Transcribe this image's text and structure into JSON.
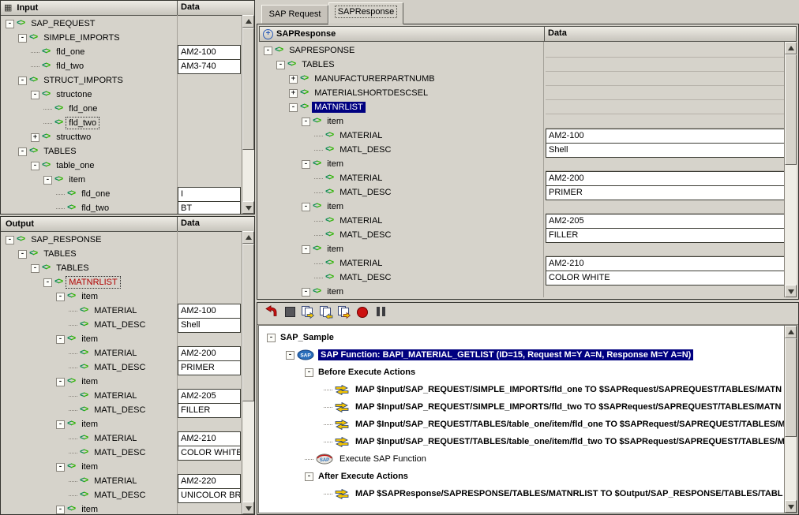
{
  "icons": {
    "xml_open": "<",
    "xml_close": ">",
    "grid_glyph": "▦",
    "plus_circle_glyph": "+"
  },
  "colors": {
    "selection": "#000080",
    "node_red": "#b20000",
    "xml_left": "#0a8a50",
    "xml_right": "#2ab400"
  },
  "tabs": {
    "items": [
      {
        "label": "SAP Request",
        "active": false
      },
      {
        "label": "SAPResponse",
        "active": true
      }
    ]
  },
  "input_panel": {
    "title": "Input",
    "data_header": "Data",
    "rows": [
      {
        "t": "SAP_REQUEST",
        "l": 0,
        "e": "-"
      },
      {
        "t": "SIMPLE_IMPORTS",
        "l": 1,
        "e": "-"
      },
      {
        "t": "fld_one",
        "l": 2,
        "v": "AM2-100"
      },
      {
        "t": "fld_two",
        "l": 2,
        "v": "AM3-740"
      },
      {
        "t": "STRUCT_IMPORTS",
        "l": 1,
        "e": "-"
      },
      {
        "t": "structone",
        "l": 2,
        "e": "-"
      },
      {
        "t": "fld_one",
        "l": 3
      },
      {
        "t": "fld_two",
        "l": 3,
        "focus": true
      },
      {
        "t": "structtwo",
        "l": 2,
        "e": "+"
      },
      {
        "t": "TABLES",
        "l": 1,
        "e": "-"
      },
      {
        "t": "table_one",
        "l": 2,
        "e": "-"
      },
      {
        "t": "item",
        "l": 3,
        "e": "-"
      },
      {
        "t": "fld_one",
        "l": 4,
        "v": "I"
      },
      {
        "t": "fld_two",
        "l": 4,
        "v": "BT"
      }
    ]
  },
  "output_panel": {
    "title": "Output",
    "data_header": "Data",
    "rows": [
      {
        "t": "SAP_RESPONSE",
        "l": 0,
        "e": "-"
      },
      {
        "t": "TABLES",
        "l": 1,
        "e": "-"
      },
      {
        "t": "TABLES",
        "l": 2,
        "e": "-"
      },
      {
        "t": "MATNRLIST",
        "l": 3,
        "e": "-",
        "red": true,
        "focus": true
      },
      {
        "t": "item",
        "l": 4,
        "e": "-"
      },
      {
        "t": "MATERIAL",
        "l": 5,
        "v": "AM2-100"
      },
      {
        "t": "MATL_DESC",
        "l": 5,
        "v": "Shell"
      },
      {
        "t": "item",
        "l": 4,
        "e": "-"
      },
      {
        "t": "MATERIAL",
        "l": 5,
        "v": "AM2-200"
      },
      {
        "t": "MATL_DESC",
        "l": 5,
        "v": "PRIMER"
      },
      {
        "t": "item",
        "l": 4,
        "e": "-"
      },
      {
        "t": "MATERIAL",
        "l": 5,
        "v": "AM2-205"
      },
      {
        "t": "MATL_DESC",
        "l": 5,
        "v": "FILLER"
      },
      {
        "t": "item",
        "l": 4,
        "e": "-"
      },
      {
        "t": "MATERIAL",
        "l": 5,
        "v": "AM2-210"
      },
      {
        "t": "MATL_DESC",
        "l": 5,
        "v": "COLOR WHITE"
      },
      {
        "t": "item",
        "l": 4,
        "e": "-"
      },
      {
        "t": "MATERIAL",
        "l": 5,
        "v": "AM2-220"
      },
      {
        "t": "MATL_DESC",
        "l": 5,
        "v": "UNICOLOR BR"
      },
      {
        "t": "item",
        "l": 4,
        "e": "-"
      }
    ]
  },
  "response_panel": {
    "title": "SAPResponse",
    "data_header": "Data",
    "rows": [
      {
        "t": "SAPRESPONSE",
        "l": 0,
        "e": "-"
      },
      {
        "t": "TABLES",
        "l": 1,
        "e": "-"
      },
      {
        "t": "MANUFACTURERPARTNUMB",
        "l": 2,
        "e": "+"
      },
      {
        "t": "MATERIALSHORTDESCSEL",
        "l": 2,
        "e": "+"
      },
      {
        "t": "MATNRLIST",
        "l": 2,
        "e": "-",
        "sel": true
      },
      {
        "t": "item",
        "l": 3,
        "e": "-"
      },
      {
        "t": "MATERIAL",
        "l": 4,
        "v": "AM2-100"
      },
      {
        "t": "MATL_DESC",
        "l": 4,
        "v": "Shell"
      },
      {
        "t": "item",
        "l": 3,
        "e": "-"
      },
      {
        "t": "MATERIAL",
        "l": 4,
        "v": "AM2-200"
      },
      {
        "t": "MATL_DESC",
        "l": 4,
        "v": "PRIMER"
      },
      {
        "t": "item",
        "l": 3,
        "e": "-"
      },
      {
        "t": "MATERIAL",
        "l": 4,
        "v": "AM2-205"
      },
      {
        "t": "MATL_DESC",
        "l": 4,
        "v": "FILLER"
      },
      {
        "t": "item",
        "l": 3,
        "e": "-"
      },
      {
        "t": "MATERIAL",
        "l": 4,
        "v": "AM2-210"
      },
      {
        "t": "MATL_DESC",
        "l": 4,
        "v": "COLOR WHITE"
      },
      {
        "t": "item",
        "l": 3,
        "e": "-"
      }
    ]
  },
  "actions_panel": {
    "rows": [
      {
        "t": "SAP_Sample",
        "l": 0,
        "e": "-",
        "bold": true
      },
      {
        "t": "SAP Function: BAPI_MATERIAL_GETLIST (ID=15, Request M=Y A=N, Response M=Y A=N)",
        "l": 1,
        "e": "-",
        "icon": "sap",
        "sel": true,
        "bold": true
      },
      {
        "t": "Before Execute Actions",
        "l": 2,
        "e": "-",
        "bold": true
      },
      {
        "t": "MAP $Input/SAP_REQUEST/SIMPLE_IMPORTS/fld_one TO $SAPRequest/SAPREQUEST/TABLES/MATN",
        "l": 3,
        "icon": "map",
        "bold": true
      },
      {
        "t": "MAP $Input/SAP_REQUEST/SIMPLE_IMPORTS/fld_two TO $SAPRequest/SAPREQUEST/TABLES/MATN",
        "l": 3,
        "icon": "map",
        "bold": true
      },
      {
        "t": "MAP $Input/SAP_REQUEST/TABLES/table_one/item/fld_one TO $SAPRequest/SAPREQUEST/TABLES/M",
        "l": 3,
        "icon": "map",
        "bold": true
      },
      {
        "t": "MAP $Input/SAP_REQUEST/TABLES/table_one/item/fld_two TO $SAPRequest/SAPREQUEST/TABLES/M",
        "l": 3,
        "icon": "map",
        "bold": true
      },
      {
        "t": "Execute SAP Function",
        "l": 2,
        "icon": "sapexec"
      },
      {
        "t": "After Execute Actions",
        "l": 2,
        "e": "-",
        "bold": true
      },
      {
        "t": "MAP $SAPResponse/SAPRESPONSE/TABLES/MATNRLIST TO $Output/SAP_RESPONSE/TABLES/TABL",
        "l": 3,
        "icon": "map",
        "bold": true
      }
    ]
  },
  "toolbar": {
    "icons": [
      "run-icon",
      "stop-icon",
      "map-copy-icon",
      "map-insert-icon",
      "map-append-icon",
      "record-icon",
      "pause-icon"
    ]
  }
}
